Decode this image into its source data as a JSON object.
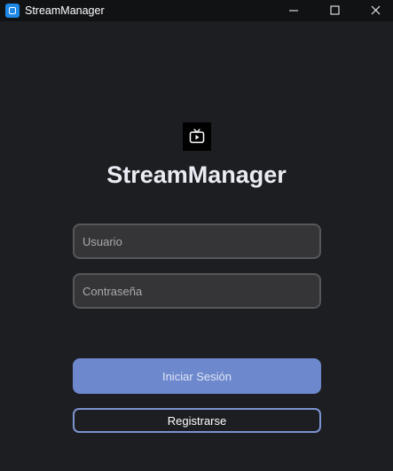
{
  "window": {
    "title": "StreamManager",
    "controls": [
      "minimize",
      "maximize",
      "close"
    ],
    "app_icon": "app-icon"
  },
  "login": {
    "logo_icon": "tv-play-icon",
    "title": "StreamManager",
    "username": {
      "value": "",
      "placeholder": "Usuario"
    },
    "password": {
      "value": "",
      "placeholder": "Contraseña"
    },
    "login_label": "Iniciar Sesión",
    "register_label": "Registrarse"
  },
  "colors": {
    "background": "#1d1e22",
    "titlebar": "#111214",
    "field_background": "#353538",
    "field_border": "#56575b",
    "primary_button": "#6d88cd",
    "register_border": "#7b93d0",
    "title_text": "#e9edf3"
  }
}
